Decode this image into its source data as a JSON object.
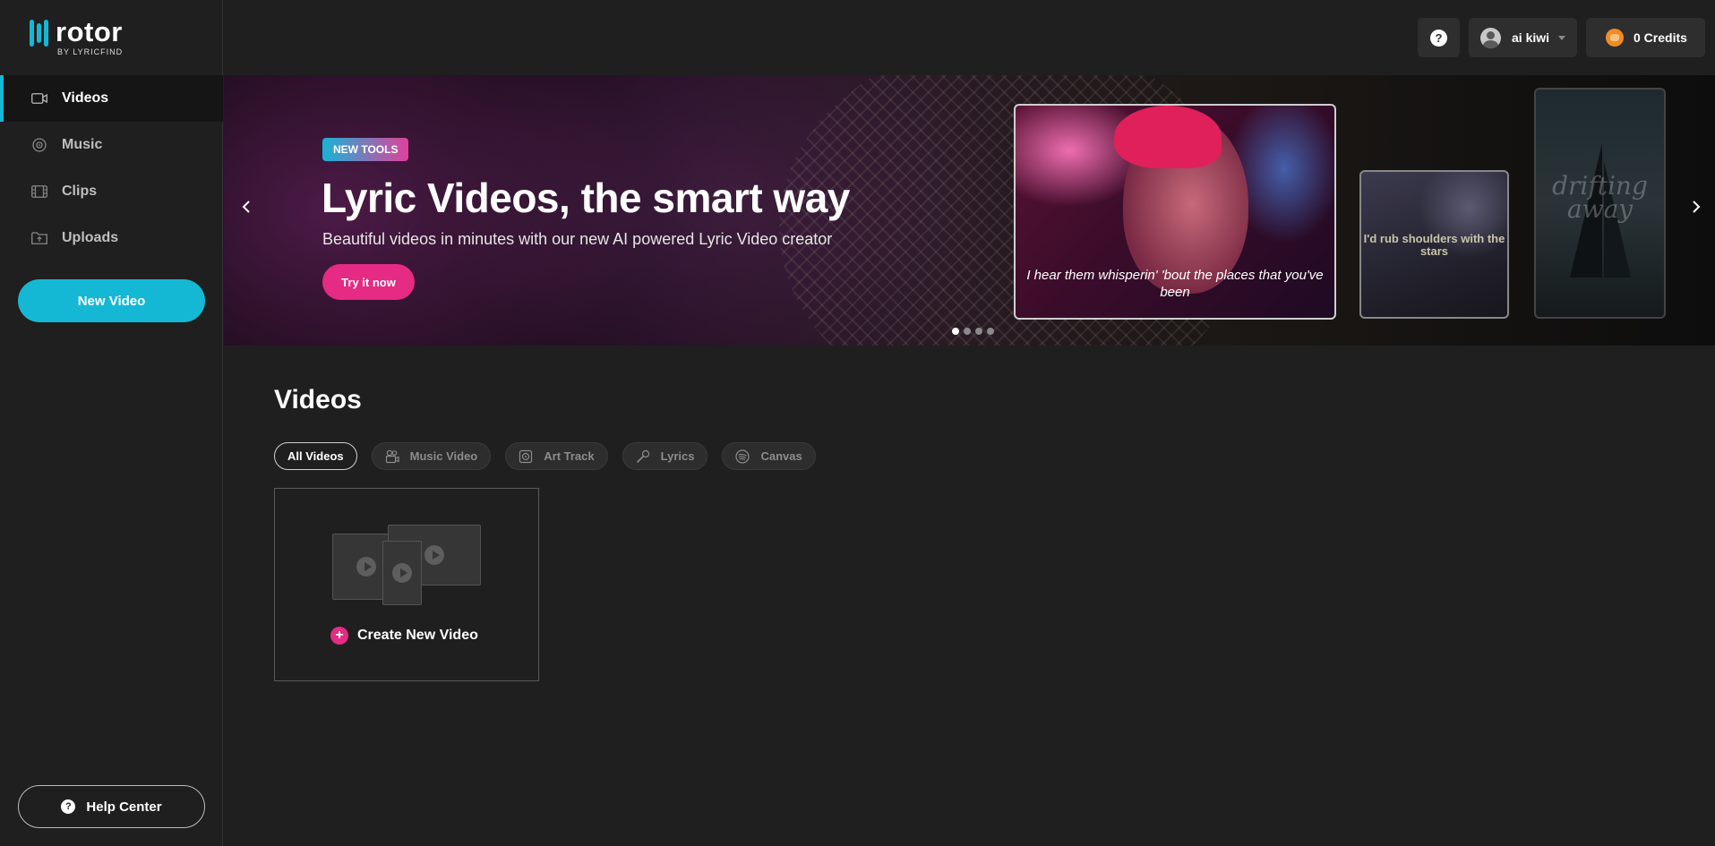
{
  "brand": {
    "name": "rotor",
    "subtitle": "BY LYRICFIND",
    "accent": "#15b8d4",
    "pink": "#e52b84"
  },
  "sidebar": {
    "items": [
      {
        "label": "Videos",
        "icon": "video-camera-icon",
        "active": true
      },
      {
        "label": "Music",
        "icon": "vinyl-disc-icon",
        "active": false
      },
      {
        "label": "Clips",
        "icon": "film-strip-icon",
        "active": false
      },
      {
        "label": "Uploads",
        "icon": "upload-folder-icon",
        "active": false
      }
    ],
    "new_video_label": "New Video",
    "help_center_label": "Help Center"
  },
  "topbar": {
    "help_icon": "question-circle-icon",
    "user_name": "ai kiwi",
    "credits_label": "0 Credits"
  },
  "hero": {
    "badge": "NEW TOOLS",
    "title": "Lyric Videos, the smart way",
    "subtitle": "Beautiful videos in minutes with our new AI powered Lyric Video creator",
    "cta_label": "Try it now",
    "preview_lyric_main": "I hear them whisperin' 'bout the places that you've been",
    "preview_lyric_small": "I'd rub shoulders with the stars",
    "preview_lyric_tall": "drifting away",
    "slide_count": 4,
    "active_slide": 1
  },
  "videos": {
    "title": "Videos",
    "filters": [
      {
        "label": "All Videos",
        "icon": "",
        "active": true
      },
      {
        "label": "Music Video",
        "icon": "camera-reel-icon",
        "active": false
      },
      {
        "label": "Art Track",
        "icon": "album-art-icon",
        "active": false
      },
      {
        "label": "Lyrics",
        "icon": "microphone-icon",
        "active": false
      },
      {
        "label": "Canvas",
        "icon": "spotify-icon",
        "active": false
      }
    ],
    "create_label": "Create New Video"
  }
}
